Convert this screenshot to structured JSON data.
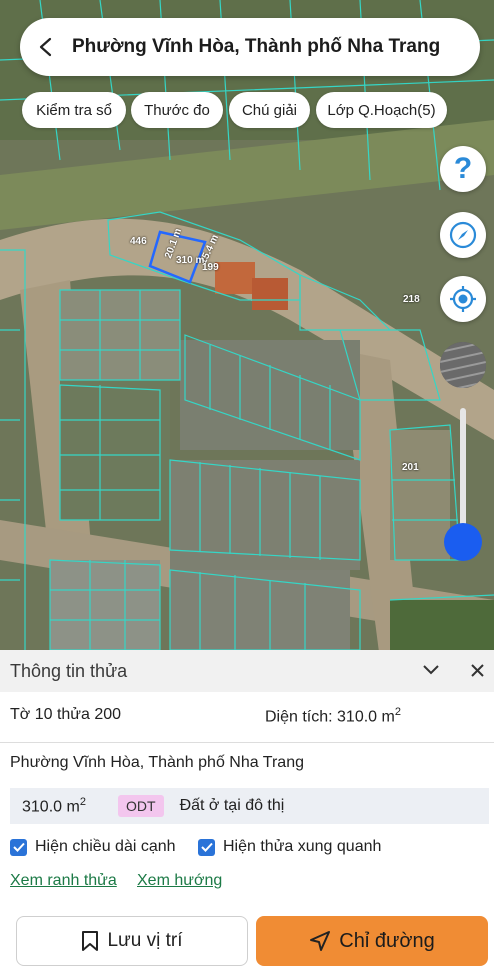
{
  "header": {
    "title": "Phường Vĩnh Hòa, Thành phố Nha Trang"
  },
  "chips": [
    "Kiểm tra sổ",
    "Thước đo",
    "Chú giải",
    "Lớp Q.Hoạch(5)"
  ],
  "map_controls": {
    "help": "?"
  },
  "map_labels": {
    "parcel_446": "446",
    "edge_a": "20.1 m",
    "edge_b": "15.4 m",
    "parcel_area": "310 m",
    "parcel_199": "199",
    "parcel_218": "218",
    "parcel_201": "201"
  },
  "panel": {
    "title": "Thông tin thửa",
    "sheet_parcel": "Tờ 10 thửa 200",
    "area_label": "Diện tích: 310.0 m",
    "area_sup": "2",
    "address": "Phường Vĩnh Hòa, Thành phố Nha Trang",
    "land_area": "310.0 m",
    "land_area_sup": "2",
    "land_code": "ODT",
    "land_type": "Đất ở tại đô thị",
    "cb_edges": "Hiện chiều dài cạnh",
    "cb_neighbors": "Hiện thửa xung quanh",
    "link_boundary": "Xem ranh thửa",
    "link_direction": "Xem hướng",
    "btn_save": "Lưu vị trí",
    "btn_directions": "Chỉ đường"
  },
  "colors": {
    "accent": "#f08c34",
    "slider": "#1a5df0",
    "parcel_lines": "#35d6c6",
    "highlight": "#2468ff"
  }
}
